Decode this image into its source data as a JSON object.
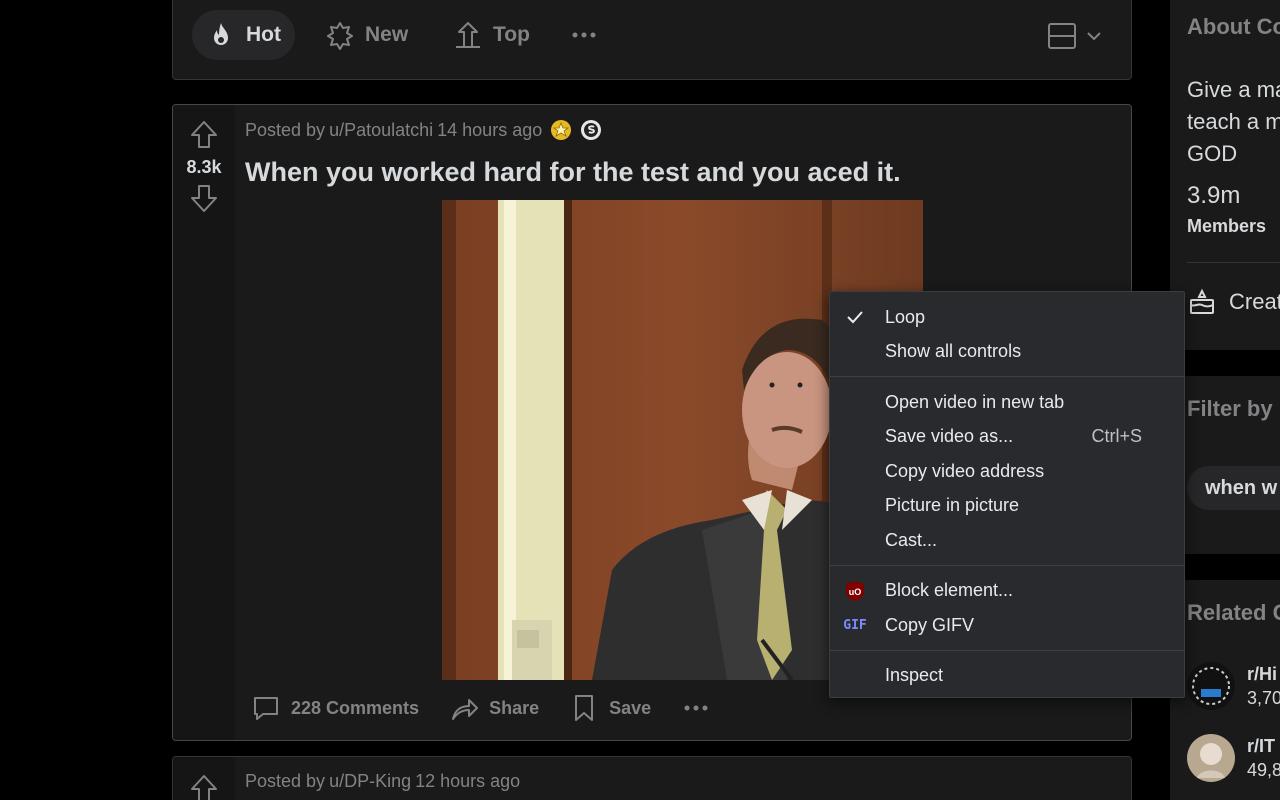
{
  "sort_bar": {
    "items": [
      {
        "label": "Hot",
        "active": true
      },
      {
        "label": "New",
        "active": false
      },
      {
        "label": "Top",
        "active": false
      }
    ]
  },
  "post": {
    "meta_prefix": "Posted by",
    "author": "u/Patoulatchi",
    "time": "14 hours ago",
    "votes": "8.3k",
    "title": "When you worked hard for the test and you aced it.",
    "actions": {
      "comments": "228 Comments",
      "share": "Share",
      "save": "Save"
    }
  },
  "post2": {
    "meta_prefix": "Posted by",
    "author": "u/DP-King",
    "time": "12 hours ago"
  },
  "sidebar": {
    "about_title": "About Co",
    "desc_lines": [
      "Give a ma",
      "teach a m",
      "GOD"
    ],
    "members_count": "3.9m",
    "members_label": "Members",
    "create_label": "Creat",
    "filter_title": "Filter by",
    "filter_chip": "when w",
    "related_title": "Related C",
    "related": [
      {
        "name": "r/Hi",
        "count": "3,70"
      },
      {
        "name": "r/IT",
        "count": "49,8"
      }
    ]
  },
  "context_menu": {
    "items": [
      {
        "label": "Loop",
        "checked": true
      },
      {
        "label": "Show all controls"
      },
      {
        "label": "Open video in new tab"
      },
      {
        "label": "Save video as...",
        "shortcut": "Ctrl+S"
      },
      {
        "label": "Copy video address"
      },
      {
        "label": "Picture in picture"
      },
      {
        "label": "Cast..."
      },
      {
        "label": "Block element...",
        "icon": "ublock-icon"
      },
      {
        "label": "Copy GIFV",
        "icon": "gif-icon",
        "icon_text": "GIF"
      },
      {
        "label": "Inspect"
      }
    ]
  },
  "colors": {
    "background": "#000000",
    "card": "#1a1a1b",
    "menu": "#292a2d",
    "text": "#d7dadc",
    "muted": "#818384"
  }
}
